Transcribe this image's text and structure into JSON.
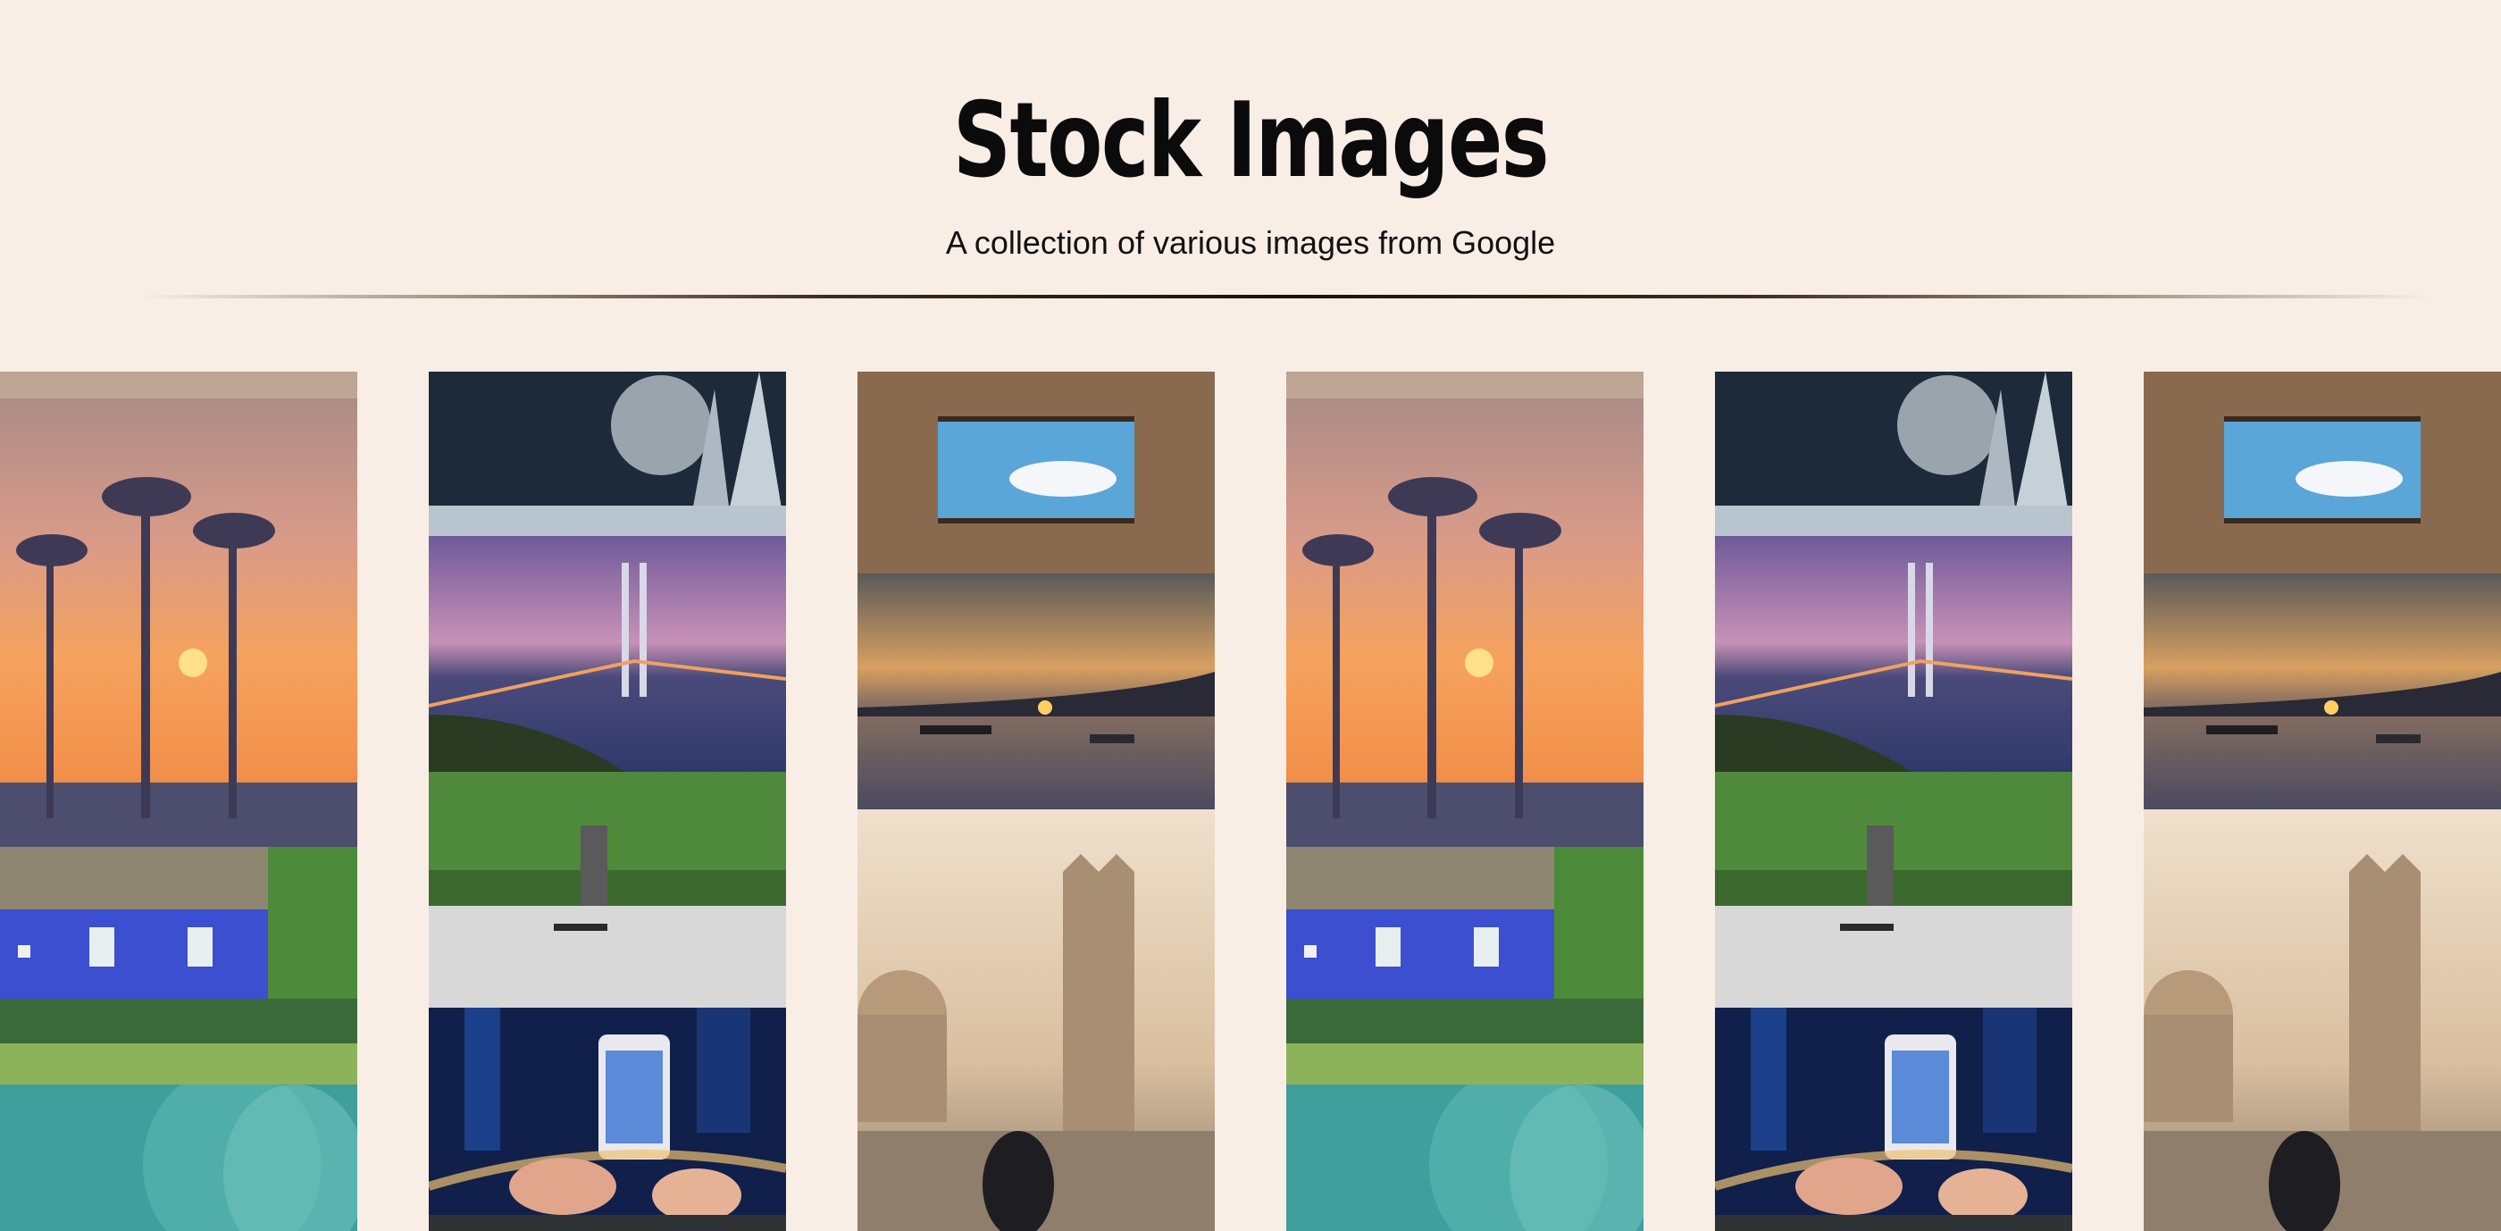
{
  "header": {
    "title": "Stock Images",
    "subtitle": "A collection of various images from Google"
  },
  "gallery": {
    "columns": [
      [
        "palm-sunset",
        "blue-cottage",
        "teal-abstract"
      ],
      [
        "moon-landscape",
        "suspension-bridge",
        "skateboarder",
        "phone-city-night",
        "dark-image"
      ],
      [
        "courtyard-sky",
        "sea-sunset-boats",
        "prague-bridge"
      ],
      [
        "palm-sunset",
        "blue-cottage",
        "teal-abstract"
      ],
      [
        "moon-landscape",
        "suspension-bridge",
        "skateboarder",
        "phone-city-night",
        "dark-image"
      ],
      [
        "courtyard-sky",
        "sea-sunset-boats",
        "prague-bridge"
      ]
    ]
  },
  "colors": {
    "background": "#f8eee6",
    "title": "#0b0b0b",
    "divider": "#1a120b"
  }
}
